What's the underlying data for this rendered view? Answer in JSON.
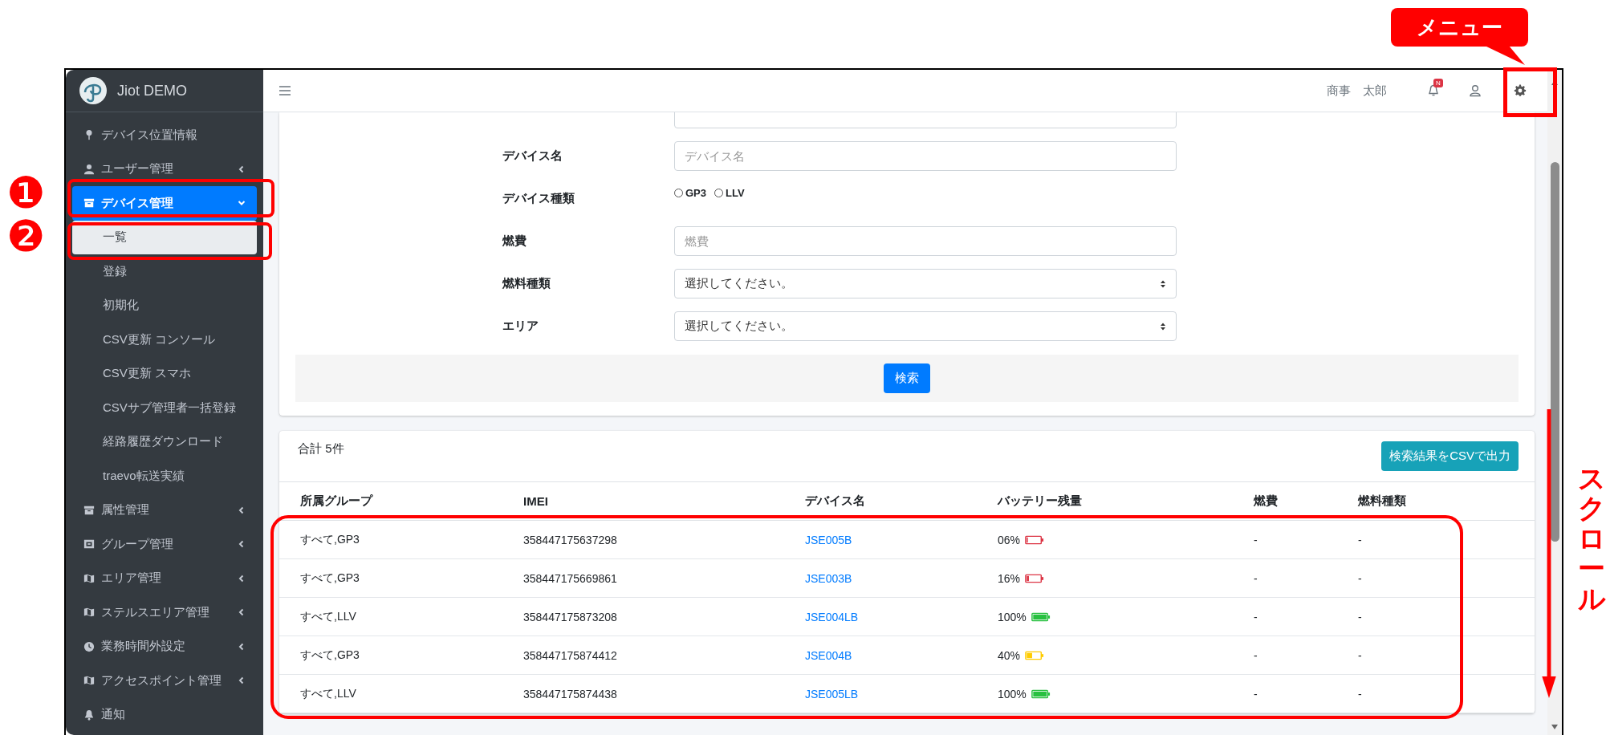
{
  "annotations": {
    "markers": [
      "❶",
      "❷"
    ],
    "callout": "メニュー",
    "scroll_label": "スクロール"
  },
  "sidebar": {
    "brand": "Jiot DEMO",
    "items": [
      {
        "label": "デバイス位置情報",
        "selected": false
      },
      {
        "label": "ユーザー管理",
        "selected": false,
        "expanded": false
      },
      {
        "label": "デバイス管理",
        "selected": true,
        "expanded": true,
        "children": [
          {
            "label": "一覧",
            "selected": true
          },
          {
            "label": "登録",
            "selected": false
          },
          {
            "label": "初期化",
            "selected": false
          },
          {
            "label": "CSV更新 コンソール",
            "selected": false
          },
          {
            "label": "CSV更新 スマホ",
            "selected": false
          },
          {
            "label": "CSVサブ管理者一括登録",
            "selected": false
          },
          {
            "label": "経路履歴ダウンロード",
            "selected": false
          },
          {
            "label": "traevo転送実績",
            "selected": false
          }
        ]
      },
      {
        "label": "属性管理",
        "selected": false,
        "expanded": false
      },
      {
        "label": "グループ管理",
        "selected": false,
        "expanded": false
      },
      {
        "label": "エリア管理",
        "selected": false,
        "expanded": false
      },
      {
        "label": "ステルスエリア管理",
        "selected": false,
        "expanded": false
      },
      {
        "label": "業務時間外設定",
        "selected": false,
        "expanded": false
      },
      {
        "label": "アクセスポイント管理",
        "selected": false,
        "expanded": false
      },
      {
        "label": "通知",
        "selected": false
      }
    ]
  },
  "topbar": {
    "user_name": "商事　太郎",
    "notification_badge": "N"
  },
  "search_form": {
    "fields": [
      {
        "label": "デバイス名",
        "kind": "text",
        "placeholder": "デバイス名"
      },
      {
        "label": "デバイス種類",
        "kind": "radio",
        "options": [
          {
            "label": "GP3",
            "selected": false
          },
          {
            "label": "LLV",
            "selected": false
          }
        ]
      },
      {
        "label": "燃費",
        "kind": "text",
        "placeholder": "燃費"
      },
      {
        "label": "燃料種類",
        "kind": "select",
        "value": "選択してください。"
      },
      {
        "label": "エリア",
        "kind": "select",
        "value": "選択してください。"
      }
    ],
    "search_button": "検索"
  },
  "results": {
    "total": "合計 5件",
    "export_button": "検索結果をCSVで出力",
    "columns": [
      "所属グループ",
      "IMEI",
      "デバイス名",
      "バッテリー残量",
      "燃費",
      "燃料種類"
    ],
    "rows": [
      {
        "group": "すべて,GP3",
        "imei": "358447175637298",
        "device": "JSE005B",
        "battery": {
          "reading": "06%",
          "level": 0.06,
          "color": "#dc3545"
        },
        "fuel_economy": "-",
        "fuel_type": "-"
      },
      {
        "group": "すべて,GP3",
        "imei": "358447175669861",
        "device": "JSE003B",
        "battery": {
          "reading": "16%",
          "level": 0.16,
          "color": "#dc3545"
        },
        "fuel_economy": "-",
        "fuel_type": "-"
      },
      {
        "group": "すべて,LLV",
        "imei": "358447175873208",
        "device": "JSE004LB",
        "battery": {
          "reading": "100%",
          "level": 1,
          "color": "#28c040"
        },
        "fuel_economy": "-",
        "fuel_type": "-"
      },
      {
        "group": "すべて,GP3",
        "imei": "358447175874412",
        "device": "JSE004B",
        "battery": {
          "reading": "40%",
          "level": 0.4,
          "color": "#ffcc00"
        },
        "fuel_economy": "-",
        "fuel_type": "-"
      },
      {
        "group": "すべて,LLV",
        "imei": "358447175874438",
        "device": "JSE005LB",
        "battery": {
          "reading": "100%",
          "level": 1,
          "color": "#28c040"
        },
        "fuel_economy": "-",
        "fuel_type": "-"
      }
    ]
  }
}
